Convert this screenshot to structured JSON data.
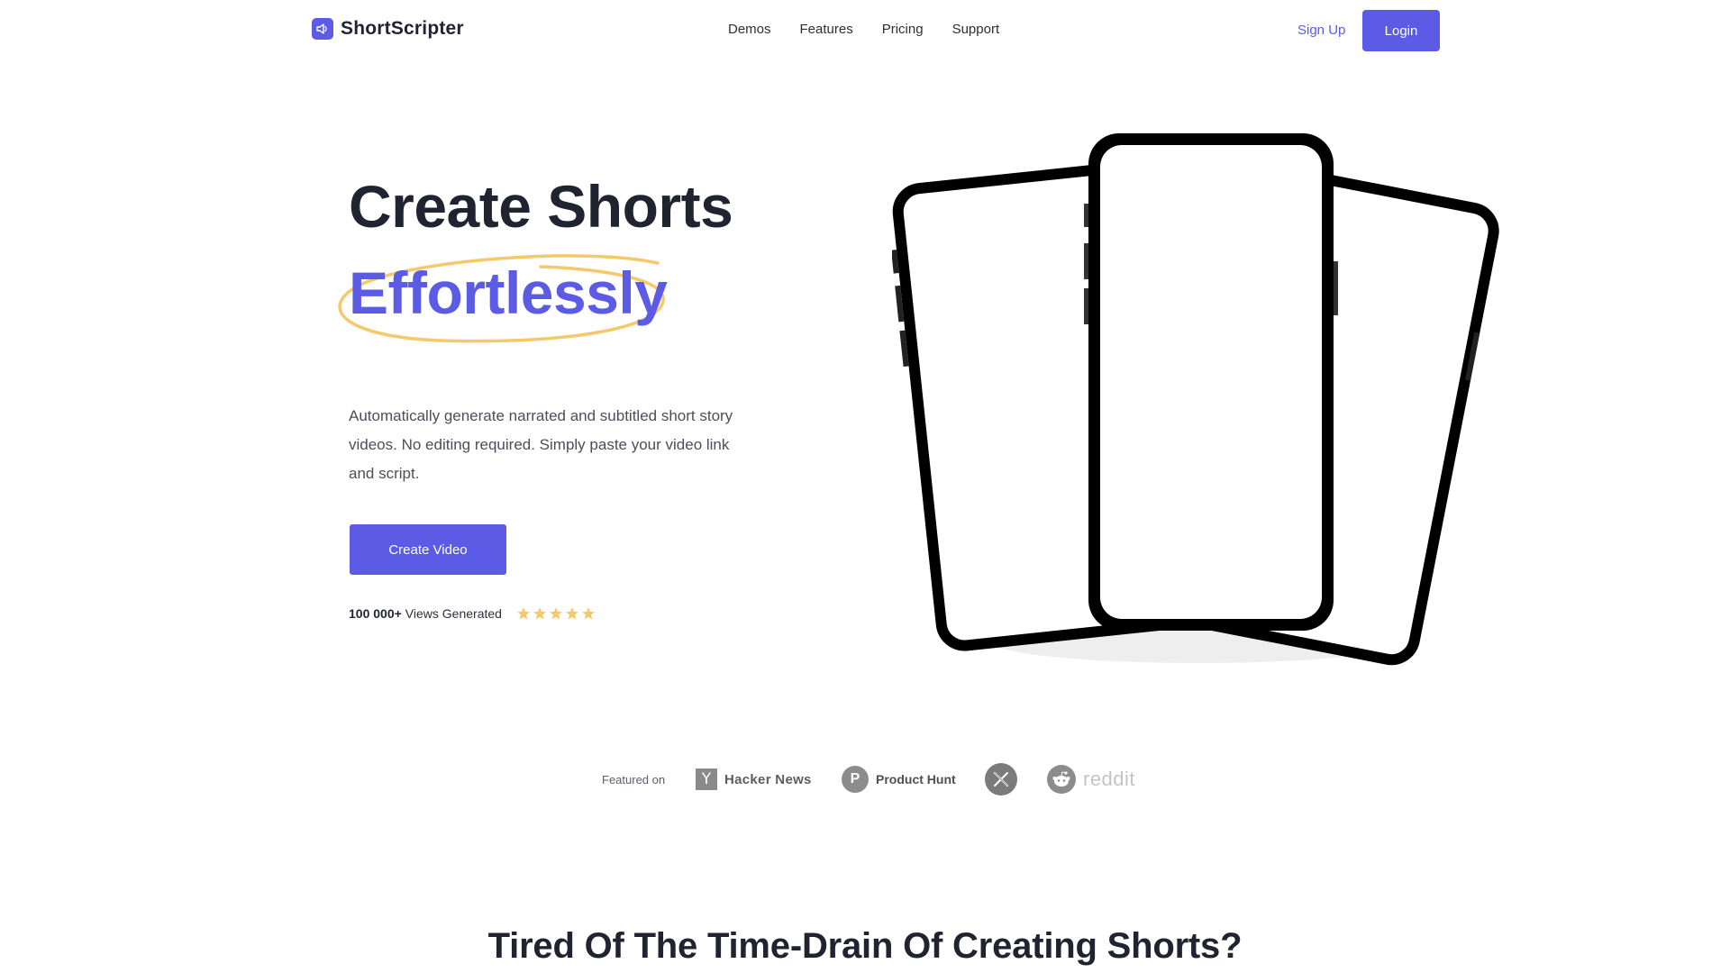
{
  "brand": {
    "name": "ShortScripter",
    "logo_icon": "speaker-icon",
    "accent": "#5b5be6",
    "highlight": "#f5c96b"
  },
  "nav": {
    "items": [
      "Demos",
      "Features",
      "Pricing",
      "Support"
    ]
  },
  "auth": {
    "signup_label": "Sign Up",
    "login_label": "Login"
  },
  "hero": {
    "title_line1": "Create Shorts",
    "title_line2": "Effortlessly",
    "description": "Automatically generate narrated and subtitled short story videos. No editing required. Simply paste your video link and script.",
    "cta_label": "Create Video",
    "views_count": "100 000+",
    "views_label": "Views Generated",
    "rating": 5,
    "rating_max": 5
  },
  "featured": {
    "label": "Featured on",
    "hacker_news": {
      "icon_letter": "Y",
      "name": "Hacker News"
    },
    "product_hunt": {
      "icon_letter": "P",
      "name": "Product Hunt"
    },
    "x_icon": "x-logo-icon",
    "reddit": {
      "icon": "reddit-alien-icon",
      "name": "reddit"
    }
  },
  "section2": {
    "title": "Tired Of The Time-Drain Of Creating Shorts?"
  }
}
